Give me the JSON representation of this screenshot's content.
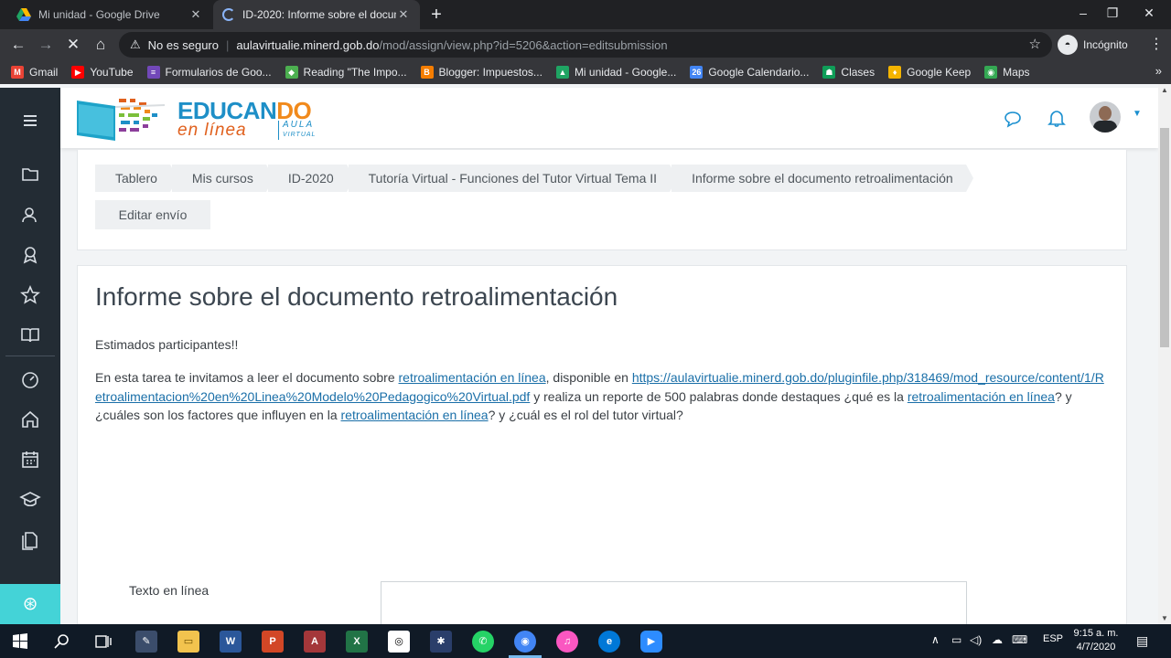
{
  "browser": {
    "tabs": [
      {
        "title": "Mi unidad - Google Drive",
        "active": false
      },
      {
        "title": "ID-2020: Informe sobre el docum",
        "active": true
      }
    ],
    "new_tab": "+",
    "window_controls": [
      "–",
      "❐",
      "✕"
    ],
    "url_warning": "No es seguro",
    "url_host": "aulavirtualie.minerd.gob.do",
    "url_path": "/mod/assign/view.php?id=5206&action=editsubmission",
    "profile_label": "Incógnito",
    "bookmarks": [
      {
        "label": "Gmail",
        "icon": "gmail-icon",
        "color": "#ea4335"
      },
      {
        "label": "YouTube",
        "icon": "youtube-icon",
        "color": "#ff0000"
      },
      {
        "label": "Formularios de Goo...",
        "icon": "forms-icon",
        "color": "#7248b9"
      },
      {
        "label": "Reading \"The Impo...",
        "icon": "reading-icon",
        "color": "#4caf50"
      },
      {
        "label": "Blogger: Impuestos...",
        "icon": "blogger-icon",
        "color": "#f57d00"
      },
      {
        "label": "Mi unidad - Google...",
        "icon": "drive-icon",
        "color": "#1fa463"
      },
      {
        "label": "Google Calendario...",
        "icon": "calendar-icon",
        "color": "#4285f4",
        "badge": "26"
      },
      {
        "label": "Clases",
        "icon": "classroom-icon",
        "color": "#0f9d58"
      },
      {
        "label": "Google Keep",
        "icon": "keep-icon",
        "color": "#f4b400"
      },
      {
        "label": "Maps",
        "icon": "maps-icon",
        "color": "#34a853"
      }
    ]
  },
  "site": {
    "logo_word_main": "EDUCAN",
    "logo_word_accent": "DO",
    "logo_sub": "en línea",
    "logo_aula": "AULA",
    "logo_virtual": "VIRTUAL"
  },
  "breadcrumbs": [
    "Tablero",
    "Mis cursos",
    "ID-2020",
    "Tutoría Virtual - Funciones del Tutor Virtual Tema II",
    "Informe sobre el documento retroalimentación"
  ],
  "edit_button": "Editar envío",
  "main": {
    "title": "Informe sobre el documento retroalimentación",
    "greeting": "Estimados participantes!!",
    "p1_before": "En esta tarea te invitamos a leer el documento sobre ",
    "link1": "retroalimentación en línea",
    "p1_mid": ", disponible en ",
    "link2": "https://aulavirtualie.minerd.gob.do/pluginfile.php/318469/mod_resource/content/1/Retroalimentacion%20en%20Linea%20Modelo%20Pedagogico%20Virtual.pdf",
    "p1_mid2": " y realiza un reporte de 500 palabras  donde destaques  ¿qué es la ",
    "link3": "retroalimentación en línea",
    "p1_mid3": "? y ¿cuáles son los factores que influyen en la ",
    "link4": "retroalimentación en línea",
    "p1_end": "? y ¿cuál es el rol del tutor virtual?",
    "field_label": "Texto en línea"
  },
  "taskbar": {
    "language": "ESP",
    "time": "9:15 a. m.",
    "date": "4/7/2020"
  }
}
